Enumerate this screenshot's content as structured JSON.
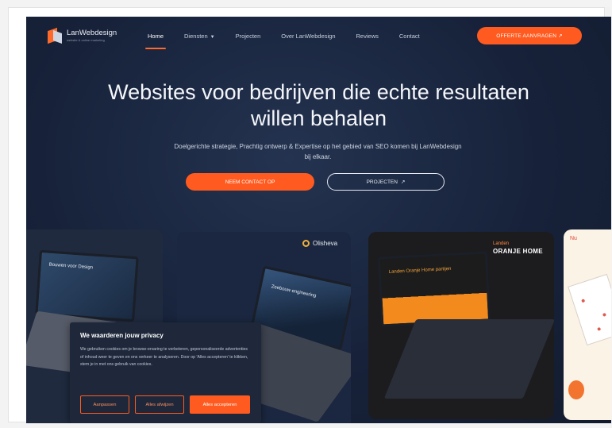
{
  "site": {
    "brand": "LanWebdesign",
    "brand_tagline": "website & online marketing"
  },
  "nav": {
    "items": [
      {
        "label": "Home",
        "active": true
      },
      {
        "label": "Diensten",
        "dropdown": true
      },
      {
        "label": "Projecten"
      },
      {
        "label": "Over LanWebdesign"
      },
      {
        "label": "Reviews"
      },
      {
        "label": "Contact"
      }
    ],
    "cta": "OFFERTE AANVRAGEN ↗"
  },
  "hero": {
    "title_line1": "Websites voor bedrijven die echte resultaten",
    "title_line2": "willen behalen",
    "subtitle": "Doelgerichte strategie, Prachtig ontwerp & Expertise op het gebied van SEO komen bij LanWebdesign bij elkaar.",
    "btn_primary": "NEEM CONTACT OP",
    "btn_secondary": "PROJECTEN",
    "btn_secondary_icon": "↗"
  },
  "cards": {
    "card1_screen_title": "Bouwen voor Design",
    "card2_brand": "Olisheva",
    "card2_screen_title": "Zeebouw engineering",
    "card3_brand_line1": "Landen",
    "card3_brand_line2": "ORANJE HOME",
    "card3_screen_title": "Landen Oranje Home partijen",
    "card4_brand": "Nu"
  },
  "cookie": {
    "title": "We waarderen jouw privacy",
    "text": "We gebruiken cookies om je browse-ervaring te verbeteren, gepersonaliseerde advertenties of inhoud weer te geven en ons verkeer te analyseren. Door op 'Alles accepteren' te klikken, stem je in met ons gebruik van cookies.",
    "buttons": [
      "Aanpassen",
      "Alles afwijzen",
      "Alles accepteren"
    ]
  },
  "colors": {
    "accent": "#ff5a1f",
    "hero_bg": "#17223a",
    "cookie_bg": "#1e283a"
  }
}
